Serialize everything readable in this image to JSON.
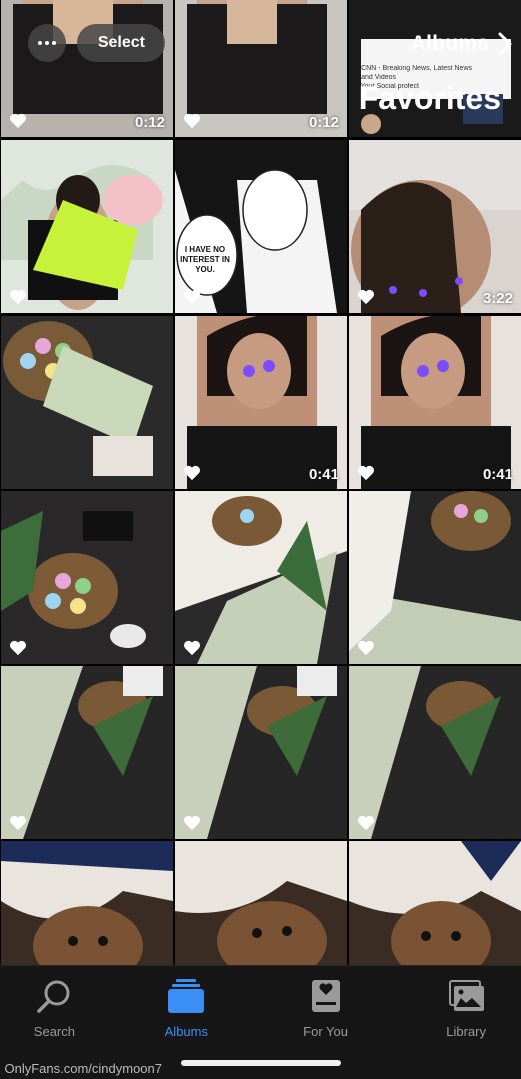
{
  "header": {
    "back_label": "Albums",
    "title": "Favorites",
    "select_label": "Select"
  },
  "tiles": [
    {
      "id": "r1c1",
      "duration": "",
      "favorite": true,
      "image": "photo with snippet of a social feed"
    },
    {
      "id": "r1c2",
      "duration": "0:12",
      "favorite": true,
      "image": "video still"
    },
    {
      "id": "r1c3",
      "duration": "0:12",
      "favorite": true,
      "image": "video still"
    },
    {
      "id": "r2c1",
      "duration": "3:22",
      "favorite": true,
      "image": "selfie"
    },
    {
      "id": "r2c2",
      "duration": "",
      "favorite": true,
      "image": "manga panel"
    },
    {
      "id": "r2c3",
      "duration": "",
      "favorite": true,
      "image": "photo"
    },
    {
      "id": "r3c1",
      "duration": "0:41",
      "favorite": true,
      "image": "photo"
    },
    {
      "id": "r3c2",
      "duration": "0:41",
      "favorite": true,
      "image": "photo"
    },
    {
      "id": "r3c3",
      "duration": "",
      "favorite": false,
      "image": "dollar bill and easter eggs"
    },
    {
      "id": "r4c1",
      "duration": "",
      "favorite": true,
      "image": "dollar bills"
    },
    {
      "id": "r4c2",
      "duration": "",
      "favorite": true,
      "image": "dollar bills and plant"
    },
    {
      "id": "r4c3",
      "duration": "",
      "favorite": true,
      "image": "easter eggs and plant"
    },
    {
      "id": "r5c1",
      "duration": "",
      "favorite": true,
      "image": "dollar bill"
    },
    {
      "id": "r5c2",
      "duration": "",
      "favorite": true,
      "image": "dollar bill"
    },
    {
      "id": "r5c3",
      "duration": "",
      "favorite": true,
      "image": "dollar bill"
    },
    {
      "id": "r6c1",
      "duration": "",
      "favorite": false,
      "image": "dog under blanket"
    },
    {
      "id": "r6c2",
      "duration": "",
      "favorite": false,
      "image": "dog under blanket"
    },
    {
      "id": "r6c3",
      "duration": "",
      "favorite": false,
      "image": "dog under blanket"
    }
  ],
  "tile_text": {
    "manga_speech": "I HAVE NO INTEREST IN YOU.",
    "feed_line1": "CNN - Breaking News, Latest News",
    "feed_line2": "and Videos",
    "feed_line3": "Your Social profect"
  },
  "tabbar": {
    "tabs": [
      {
        "label": "Library",
        "icon": "photo-stack-icon",
        "active": false
      },
      {
        "label": "For You",
        "icon": "for-you-icon",
        "active": false
      },
      {
        "label": "Albums",
        "icon": "albums-icon",
        "active": true
      },
      {
        "label": "Search",
        "icon": "search-icon",
        "active": false
      }
    ]
  },
  "watermark": "OnlyFans.com/cindymoon7",
  "colors": {
    "accent": "#3a8ef6",
    "tabbar_bg": "#161616",
    "inactive": "#9a9a9a"
  }
}
